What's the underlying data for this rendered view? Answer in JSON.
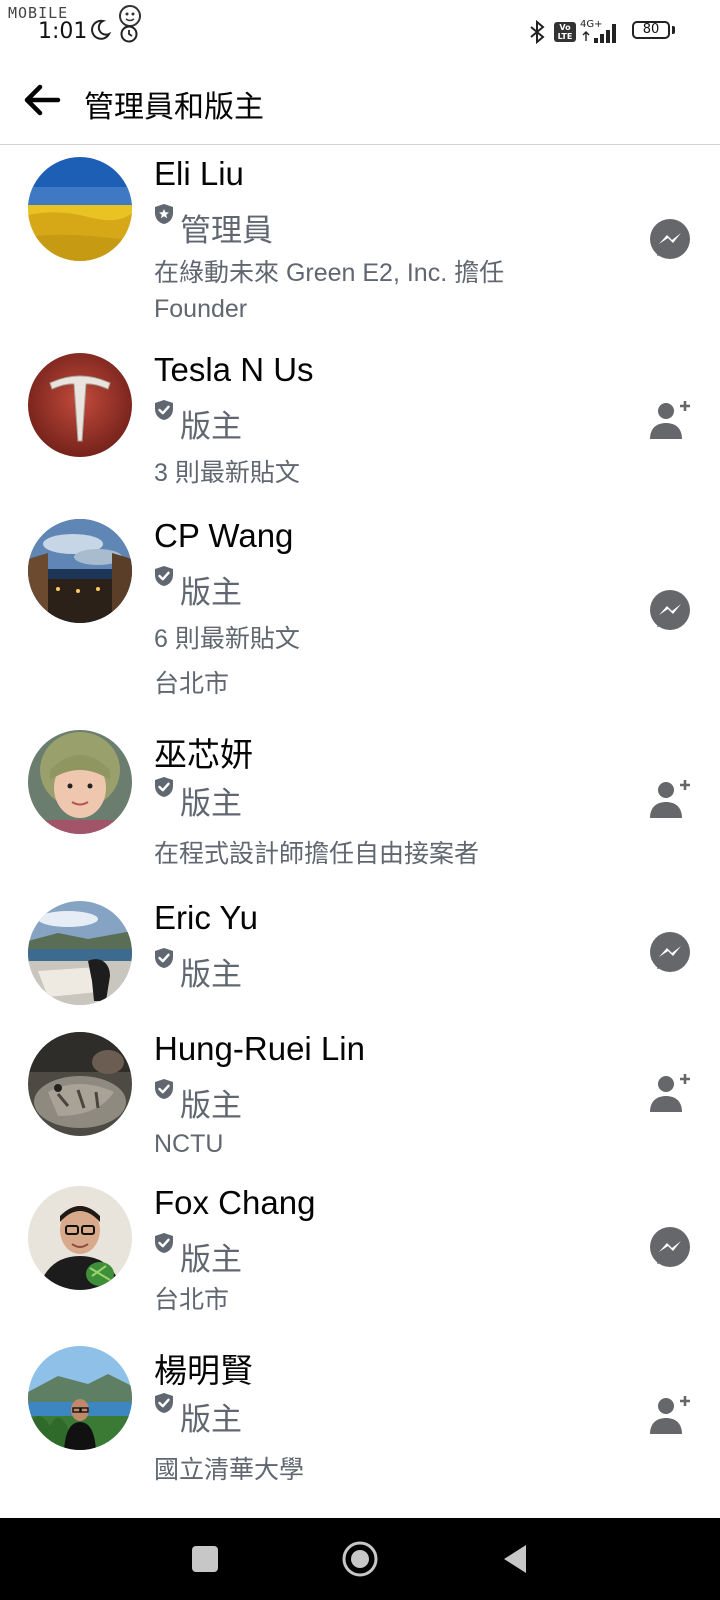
{
  "status_bar": {
    "watermark": "MOBILE",
    "time": "1:01",
    "volte": "Vo LTE",
    "network": "4G+",
    "battery": "80"
  },
  "header": {
    "title": "管理員和版主"
  },
  "members": [
    {
      "name": "Eli Liu",
      "role": "管理員",
      "role_icon": "admin-star-shield-icon",
      "details": [
        "在綠動未來 Green E2, Inc. 擔任",
        "Founder"
      ],
      "action": "messenger-icon"
    },
    {
      "name": "Tesla N Us",
      "role": "版主",
      "role_icon": "moderator-shield-icon",
      "details": [
        "3 則最新貼文"
      ],
      "action": "add-friend-icon"
    },
    {
      "name": "CP Wang",
      "role": "版主",
      "role_icon": "moderator-shield-icon",
      "details": [
        "6 則最新貼文",
        "台北市"
      ],
      "action": "messenger-icon"
    },
    {
      "name": "巫芯妍",
      "role": "版主",
      "role_icon": "moderator-shield-icon",
      "details": [
        "在程式設計師擔任自由接案者"
      ],
      "action": "add-friend-icon"
    },
    {
      "name": "Eric Yu",
      "role": "版主",
      "role_icon": "moderator-shield-icon",
      "details": [],
      "action": "messenger-icon"
    },
    {
      "name": "Hung-Ruei Lin",
      "role": "版主",
      "role_icon": "moderator-shield-icon",
      "details": [
        "NCTU"
      ],
      "action": "add-friend-icon"
    },
    {
      "name": "Fox Chang",
      "role": "版主",
      "role_icon": "moderator-shield-icon",
      "details": [
        "台北市"
      ],
      "action": "messenger-icon"
    },
    {
      "name": "楊明賢",
      "role": "版主",
      "role_icon": "moderator-shield-icon",
      "details": [
        "國立清華大學"
      ],
      "action": "add-friend-icon"
    }
  ],
  "colors": {
    "text_primary": "#050505",
    "text_secondary": "#606770",
    "icon_gray": "#65676b",
    "divider": "#cfd2d6",
    "nav_bar": "#000000"
  }
}
